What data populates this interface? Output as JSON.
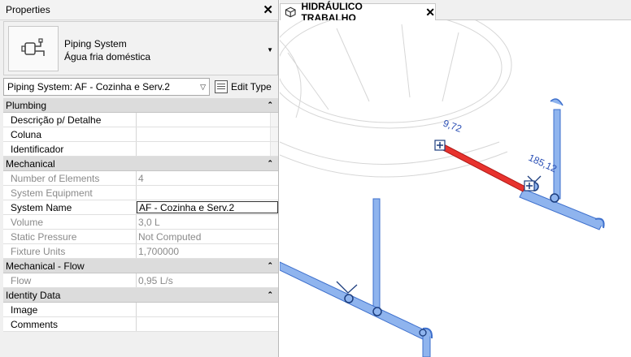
{
  "properties": {
    "title": "Properties",
    "type_selector": {
      "family": "Piping System",
      "type": "Água fria doméstica"
    },
    "instance_selector": "Piping System: AF - Cozinha e Serv.2",
    "edit_type_label": "Edit Type",
    "groups": [
      {
        "name": "Plumbing",
        "rows": [
          {
            "name": "Descrição p/ Detalhe",
            "value": ""
          },
          {
            "name": "Coluna",
            "value": ""
          },
          {
            "name": "Identificador",
            "value": ""
          }
        ]
      },
      {
        "name": "Mechanical",
        "rows": [
          {
            "name": "Number of Elements",
            "value": "4"
          },
          {
            "name": "System Equipment",
            "value": ""
          },
          {
            "name": "System Name",
            "value": "AF - Cozinha e Serv.2"
          },
          {
            "name": "Volume",
            "value": "3,0 L"
          },
          {
            "name": "Static Pressure",
            "value": "Not Computed"
          },
          {
            "name": "Fixture Units",
            "value": "1,700000"
          }
        ]
      },
      {
        "name": "Mechanical - Flow",
        "rows": [
          {
            "name": "Flow",
            "value": "0,95 L/s"
          }
        ]
      },
      {
        "name": "Identity Data",
        "rows": [
          {
            "name": "Image",
            "value": ""
          },
          {
            "name": "Comments",
            "value": ""
          }
        ]
      }
    ]
  },
  "view": {
    "tab_label": "HIDRÁULICO TRABALHO",
    "dimensions": [
      "9,72",
      "185,12"
    ],
    "colors": {
      "pipe": "#8fb4ee",
      "pipe_edge": "#3d6fcc",
      "selected": "#e8332e"
    }
  }
}
